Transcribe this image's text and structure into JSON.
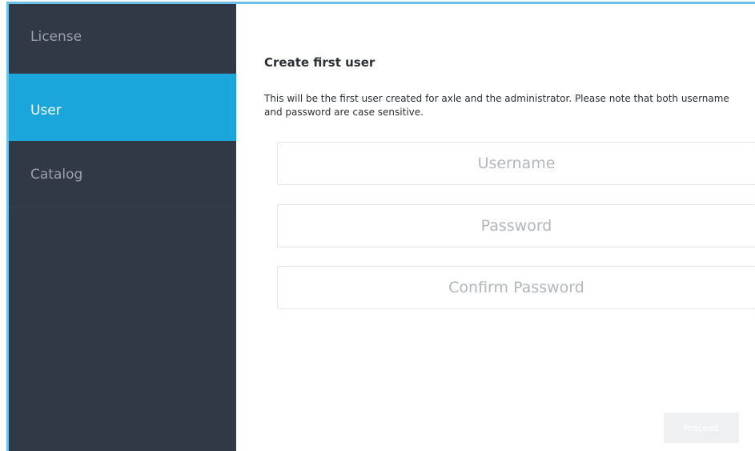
{
  "sidebar": {
    "items": [
      {
        "label": "License"
      },
      {
        "label": "User"
      },
      {
        "label": "Catalog"
      }
    ]
  },
  "main": {
    "title": "Create first user",
    "description": "This will be the first user created for axle and the administrator. Please note that both username and password are case sensitive.",
    "username_placeholder": "Username",
    "password_placeholder": "Password",
    "confirm_password_placeholder": "Confirm Password",
    "username_value": "",
    "password_value": "",
    "confirm_password_value": "",
    "proceed_label": "Proceed"
  },
  "colors": {
    "sidebar_bg": "#313846",
    "active_item_bg": "#1aa6da",
    "frame_border": "#6dc0e6"
  }
}
